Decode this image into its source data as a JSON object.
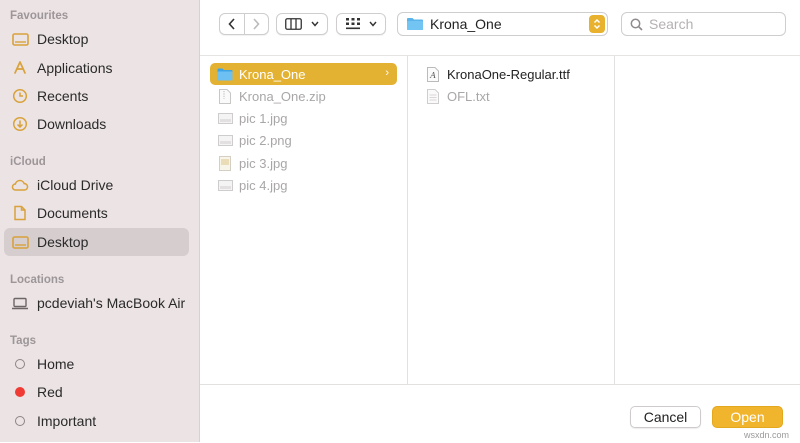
{
  "sidebar": {
    "sections": {
      "favourites": "Favourites",
      "icloud": "iCloud",
      "locations": "Locations",
      "tags": "Tags"
    },
    "favourites": [
      {
        "label": "Desktop",
        "icon": "desktop-icon"
      },
      {
        "label": "Applications",
        "icon": "applications-icon"
      },
      {
        "label": "Recents",
        "icon": "clock-icon"
      },
      {
        "label": "Downloads",
        "icon": "download-icon"
      }
    ],
    "icloud": [
      {
        "label": "iCloud Drive",
        "icon": "cloud-icon"
      },
      {
        "label": "Documents",
        "icon": "document-icon"
      },
      {
        "label": "Desktop",
        "icon": "desktop-icon",
        "selected": true
      }
    ],
    "locations": [
      {
        "label": "pcdeviah's MacBook Air",
        "icon": "laptop-icon"
      }
    ],
    "tags": [
      {
        "label": "Home",
        "color": "hollow"
      },
      {
        "label": "Red",
        "color": "#f03b35"
      },
      {
        "label": "Important",
        "color": "hollow"
      }
    ]
  },
  "toolbar": {
    "back_icon": "chevron-left-icon",
    "forward_icon": "chevron-right-icon",
    "view_icon": "column-view-icon",
    "group_icon": "grid-view-icon",
    "path_label": "Krona_One",
    "search_placeholder": "Search"
  },
  "columns": {
    "col1": [
      {
        "name": "Krona_One",
        "type": "folder",
        "selected": true
      },
      {
        "name": "Krona_One.zip",
        "type": "zip",
        "dim": true
      },
      {
        "name": "pic 1.jpg",
        "type": "image",
        "dim": true
      },
      {
        "name": "pic 2.png",
        "type": "image",
        "dim": true
      },
      {
        "name": "pic 3.jpg",
        "type": "image",
        "dim": true
      },
      {
        "name": "pic 4.jpg",
        "type": "image",
        "dim": true
      }
    ],
    "col2": [
      {
        "name": "KronaOne-Regular.ttf",
        "type": "font"
      },
      {
        "name": "OFL.txt",
        "type": "text",
        "dim": true
      }
    ]
  },
  "footer": {
    "cancel_label": "Cancel",
    "open_label": "Open"
  },
  "colors": {
    "accent": "#f1b52d",
    "sidebar_bg": "#ebe3e4",
    "sidebar_icon": "#d9a23a"
  },
  "watermark": "wsxdn.com"
}
